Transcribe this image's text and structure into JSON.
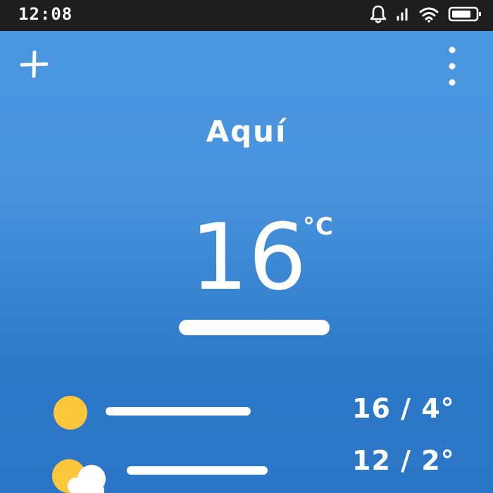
{
  "status_bar": {
    "time": "12:08",
    "icons": [
      "bell-icon",
      "signal-icon",
      "wifi-icon",
      "battery-icon"
    ]
  },
  "toolbar": {
    "add_icon": "plus-icon",
    "menu_icon": "more-vertical-icon"
  },
  "current": {
    "location": "Aquí",
    "temperature": "16",
    "unit": "°C"
  },
  "forecast": [
    {
      "icon": "sun-icon",
      "range": "16 / 4°"
    },
    {
      "icon": "partly-cloudy-icon",
      "range": "12 / 2°"
    }
  ],
  "colors": {
    "background_top": "#4a97df",
    "background_bottom": "#2b76c6",
    "status_bar": "#1e1e1e",
    "sun": "#fdc63b",
    "text": "#ffffff"
  }
}
